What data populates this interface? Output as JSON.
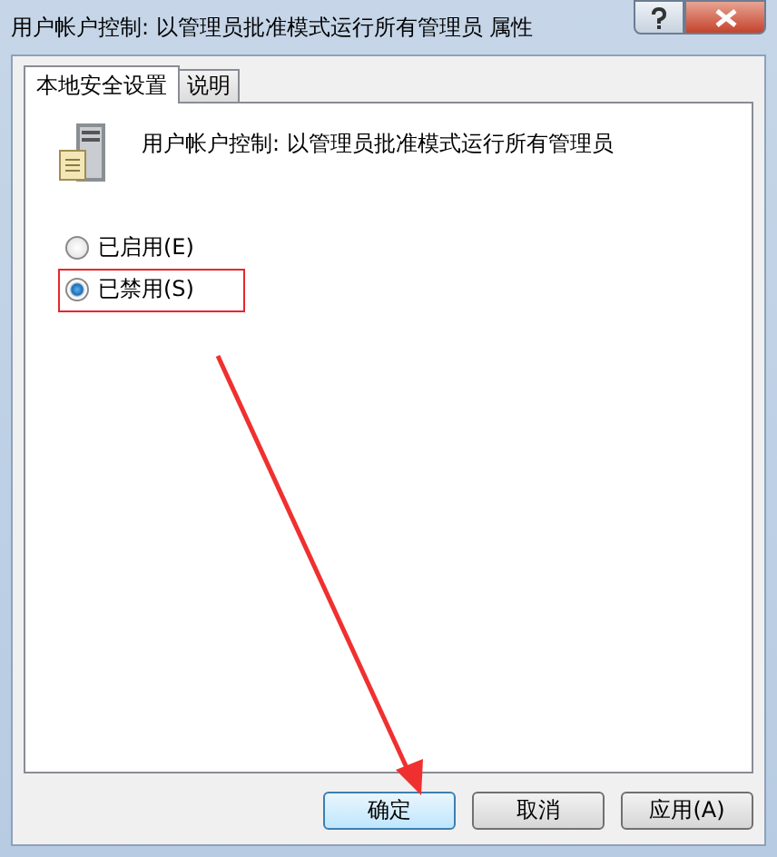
{
  "window": {
    "title": "用户帐户控制: 以管理员批准模式运行所有管理员 属性"
  },
  "tabs": [
    {
      "label": "本地安全设置",
      "selected": true
    },
    {
      "label": "说明",
      "selected": false
    }
  ],
  "policy": {
    "name": "用户帐户控制: 以管理员批准模式运行所有管理员"
  },
  "options": [
    {
      "label": "已启用(E)",
      "selected": false
    },
    {
      "label": "已禁用(S)",
      "selected": true
    }
  ],
  "buttons": [
    {
      "label": "确定",
      "default": true
    },
    {
      "label": "取消",
      "default": false
    },
    {
      "label": "应用(A)",
      "default": false
    }
  ]
}
